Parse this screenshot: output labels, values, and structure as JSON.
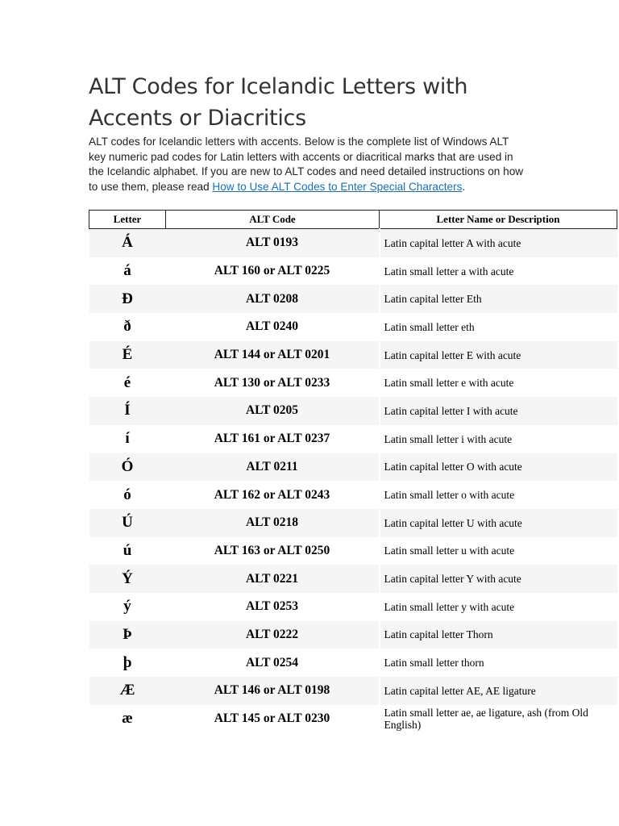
{
  "title": "ALT Codes for Icelandic Letters with Accents or Diacritics",
  "intro": "ALT codes for Icelandic letters with accents. Below is the complete list of Windows ALT key numeric pad codes for Latin letters with accents or diacritical marks that are used in the Icelandic alphabet. If you are new to ALT codes and need detailed instructions on how to use them, please read ",
  "link": "How to Use ALT Codes to Enter Special Characters",
  "period": ".",
  "headers": [
    "Letter",
    "ALT Code",
    "Letter Name or Description"
  ],
  "rows": [
    [
      "Á",
      "ALT 0193",
      "Latin capital letter A with acute"
    ],
    [
      "á",
      "ALT 160 or ALT 0225",
      "Latin small letter a with acute"
    ],
    [
      "Ð",
      "ALT 0208",
      "Latin capital letter Eth"
    ],
    [
      "ð",
      "ALT 0240",
      "Latin small letter eth"
    ],
    [
      "É",
      "ALT 144 or ALT 0201",
      "Latin capital letter E with acute"
    ],
    [
      "é",
      "ALT 130 or ALT 0233",
      "Latin small letter e with acute"
    ],
    [
      "Í",
      "ALT 0205",
      "Latin capital letter I with acute"
    ],
    [
      "í",
      "ALT 161 or ALT 0237",
      "Latin small letter i with acute"
    ],
    [
      "Ó",
      "ALT 0211",
      "Latin capital letter O with acute"
    ],
    [
      "ó",
      "ALT 162 or ALT 0243",
      "Latin small letter o with acute"
    ],
    [
      "Ú",
      "ALT 0218",
      "Latin capital letter U with acute"
    ],
    [
      "ú",
      "ALT 163 or ALT 0250",
      "Latin small letter u with acute"
    ],
    [
      "Ý",
      "ALT 0221",
      "Latin capital letter Y with acute"
    ],
    [
      "ý",
      "ALT 0253",
      "Latin small letter y with acute"
    ],
    [
      "Þ",
      "ALT 0222",
      "Latin capital letter Thorn"
    ],
    [
      "þ",
      "ALT 0254",
      "Latin small letter thorn"
    ],
    [
      "Æ",
      "ALT 146 or ALT 0198",
      "Latin capital letter AE, AE ligature"
    ],
    [
      "æ",
      "ALT 145 or ALT 0230",
      "Latin small letter ae, ae ligature, ash (from Old English)"
    ]
  ]
}
